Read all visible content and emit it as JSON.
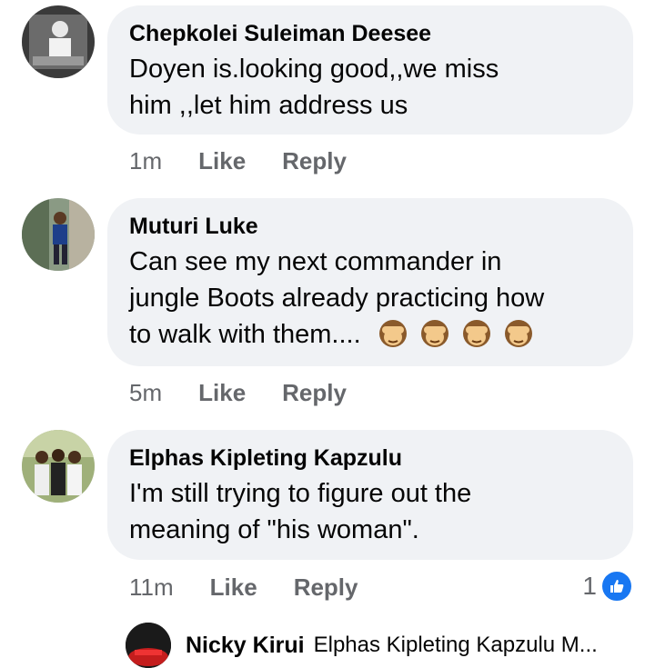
{
  "comments": [
    {
      "author": "Chepkolei Suleiman Deesee",
      "line1": "Doyen is.looking good,,we miss",
      "line2": "him ,,let him address us",
      "time": "1m",
      "like": "Like",
      "reply": "Reply"
    },
    {
      "author": "Muturi Luke",
      "line1": "Can see my next commander in",
      "line2": "jungle Boots already practicing how",
      "line3": "to walk with them....",
      "emoji": "see-no-evil-monkey-icon x4",
      "time": "5m",
      "like": "Like",
      "reply": "Reply"
    },
    {
      "author": "Elphas Kipleting Kapzulu",
      "line1": "I'm still trying to figure out the",
      "line2": "meaning of \"his woman\".",
      "time": "11m",
      "like": "Like",
      "reply": "Reply",
      "reactions": "1"
    }
  ],
  "reply_preview": {
    "author": "Nicky Kirui",
    "text": "Elphas Kipleting Kapzulu M..."
  },
  "colors": {
    "bubble": "#f0f2f5",
    "meta": "#65676b",
    "like_badge": "#1877f2"
  }
}
